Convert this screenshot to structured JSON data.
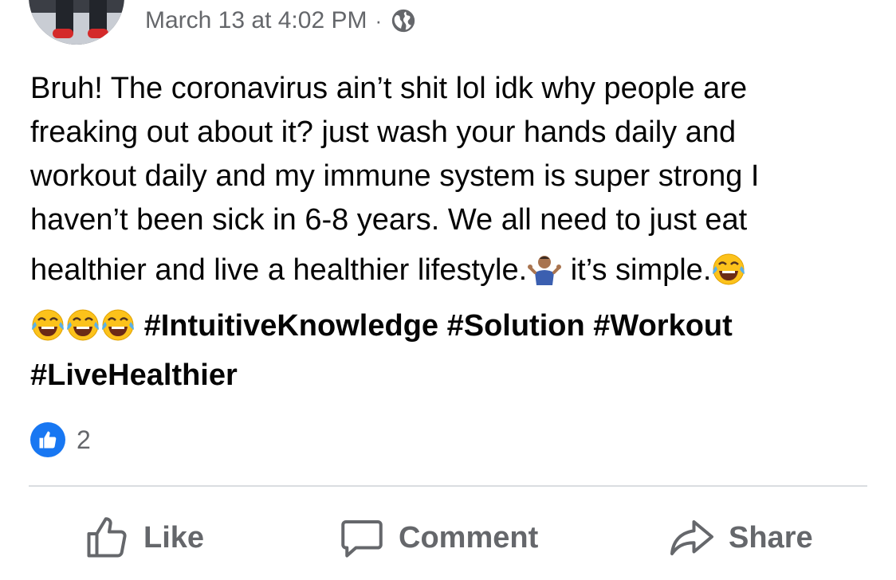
{
  "post": {
    "timestamp": "March 13 at 4:02 PM",
    "separator": "·",
    "privacy_icon": "globe-icon",
    "text_lines": [
      "Bruh! The coronavirus ain’t shit lol idk why people are",
      "freaking out about it? just wash your hands daily and",
      "workout daily and my immune system is super strong I",
      "haven’t been sick in 6-8 years. We all need to just eat"
    ],
    "line5_text": "healthier and live a healthier lifestyle.",
    "line5_text_after": " it’s simple.",
    "hashtags_line6": "#IntuitiveKnowledge #Solution #Workout",
    "hashtags_line7": "#LiveHealthier",
    "emojis": [
      "person-shrugging-emoji",
      "face-with-tears-of-joy-emoji"
    ]
  },
  "reactions": {
    "icon": "thumbs-up-icon",
    "count": "2"
  },
  "actions": {
    "like_label": "Like",
    "comment_label": "Comment",
    "share_label": "Share"
  },
  "colors": {
    "accent": "#1877f2",
    "secondary_text": "#65676b",
    "divider": "#dadde1"
  }
}
